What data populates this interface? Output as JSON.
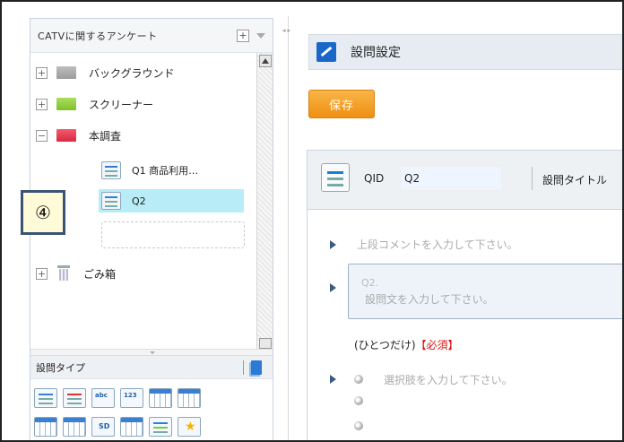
{
  "left_panel": {
    "survey_title": "CATVに関するアンケート",
    "add_label": "+",
    "tree": [
      {
        "label": "バックグラウンド",
        "toggle": "+",
        "color": "#a8a8a8"
      },
      {
        "label": "スクリーナー",
        "toggle": "+",
        "color": "#8bcc3a"
      },
      {
        "label": "本調査",
        "toggle": "−",
        "color": "#e83a50"
      }
    ],
    "questions": [
      {
        "label": "Q1 商品利用…",
        "selected": false
      },
      {
        "label": "Q2",
        "selected": true
      }
    ],
    "trash": {
      "label": "ごみ箱",
      "toggle": "+"
    },
    "callout": "④",
    "question_types_title": "設問タイプ",
    "question_type_icons": [
      "single-choice-icon",
      "multiple-choice-icon",
      "text-input-icon",
      "numeric-input-icon",
      "ranking-icon",
      "ranking-check-icon",
      "matrix-single-icon",
      "matrix-multiple-icon",
      "semantic-differential-icon",
      "grid-icon",
      "slider-icon",
      "crown-icon"
    ],
    "question_type_texts": {
      "text": "abc",
      "number": "123",
      "sd": "SD"
    }
  },
  "right_panel": {
    "header_title": "設問設定",
    "save_label": "保存",
    "qid_label": "QID",
    "qid_value": "Q2",
    "question_title_label": "設問タイトル",
    "upper_comment_placeholder": "上段コメントを入力して下さい。",
    "question_number": "Q2.",
    "question_text_placeholder": "設問文を入力して下さい。",
    "answer_mode": "(ひとつだけ)",
    "required_label": "【必須】",
    "choice_placeholder": "選択肢を入力して下さい。"
  },
  "colors": {
    "accent": "#1a67c9",
    "save_button": "#f4a024",
    "selected_row": "#b8ecf6",
    "required": "#dd1111"
  }
}
